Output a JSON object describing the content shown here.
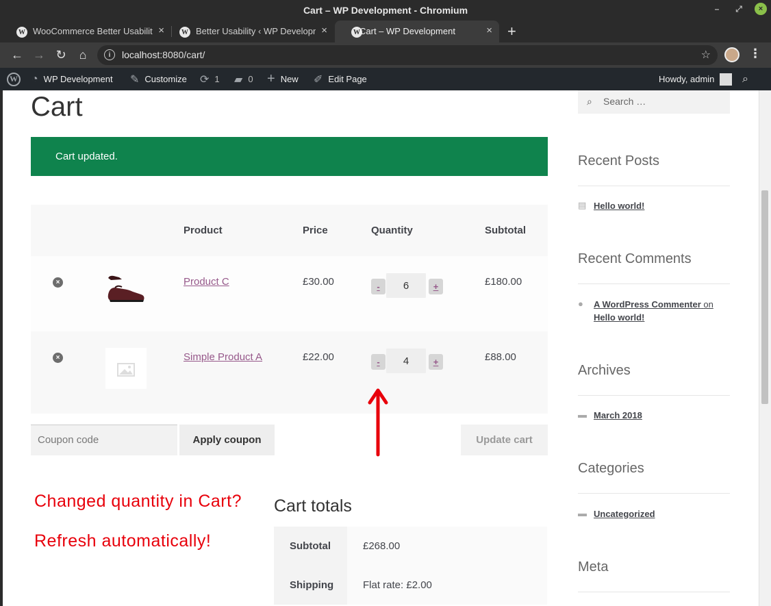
{
  "window": {
    "title": "Cart – WP Development - Chromium"
  },
  "tabs": [
    {
      "label": "WooCommerce Better Usability",
      "active": false
    },
    {
      "label": "Better Usability ‹ WP Developm",
      "active": false
    },
    {
      "label": "Cart – WP Development",
      "active": true
    }
  ],
  "toolbar": {
    "url_host": "localhost",
    "url_rest": ":8080/cart/"
  },
  "adminbar": {
    "site": "WP Development",
    "customize": "Customize",
    "updates_count": "1",
    "comments_count": "0",
    "new": "New",
    "edit": "Edit Page",
    "howdy": "Howdy, admin"
  },
  "page": {
    "title": "Cart",
    "notice": "Cart updated."
  },
  "cart": {
    "headers": {
      "product": "Product",
      "price": "Price",
      "quantity": "Quantity",
      "subtotal": "Subtotal"
    },
    "rows": [
      {
        "product": "Product C",
        "price": "£30.00",
        "qty": "6",
        "subtotal": "£180.00",
        "minus": "-",
        "plus": "+"
      },
      {
        "product": "Simple Product A",
        "price": "£22.00",
        "qty": "4",
        "subtotal": "£88.00",
        "minus": "-",
        "plus": "+"
      }
    ],
    "coupon_placeholder": "Coupon code",
    "apply_label": "Apply coupon",
    "update_label": "Update cart"
  },
  "annotation": {
    "line1": "Changed quantity in Cart?",
    "line2": "Refresh automatically!",
    "arrow_color": "#e8000b"
  },
  "totals": {
    "title": "Cart totals",
    "rows": [
      {
        "label": "Subtotal",
        "value": "£268.00"
      },
      {
        "label": "Shipping",
        "value": "Flat rate: £2.00"
      }
    ]
  },
  "sidebar": {
    "search_placeholder": "Search …",
    "recent_posts_title": "Recent Posts",
    "recent_post": "Hello world!",
    "recent_comments_title": "Recent Comments",
    "comment_author": "A WordPress Commenter",
    "comment_on": "on",
    "comment_post": "Hello world!",
    "archives_title": "Archives",
    "archive": "March 2018",
    "categories_title": "Categories",
    "category": "Uncategorized",
    "meta_title": "Meta"
  },
  "colors": {
    "notice_green": "#0f834d",
    "link_purple": "#96588a",
    "adminbar": "#23282d"
  }
}
